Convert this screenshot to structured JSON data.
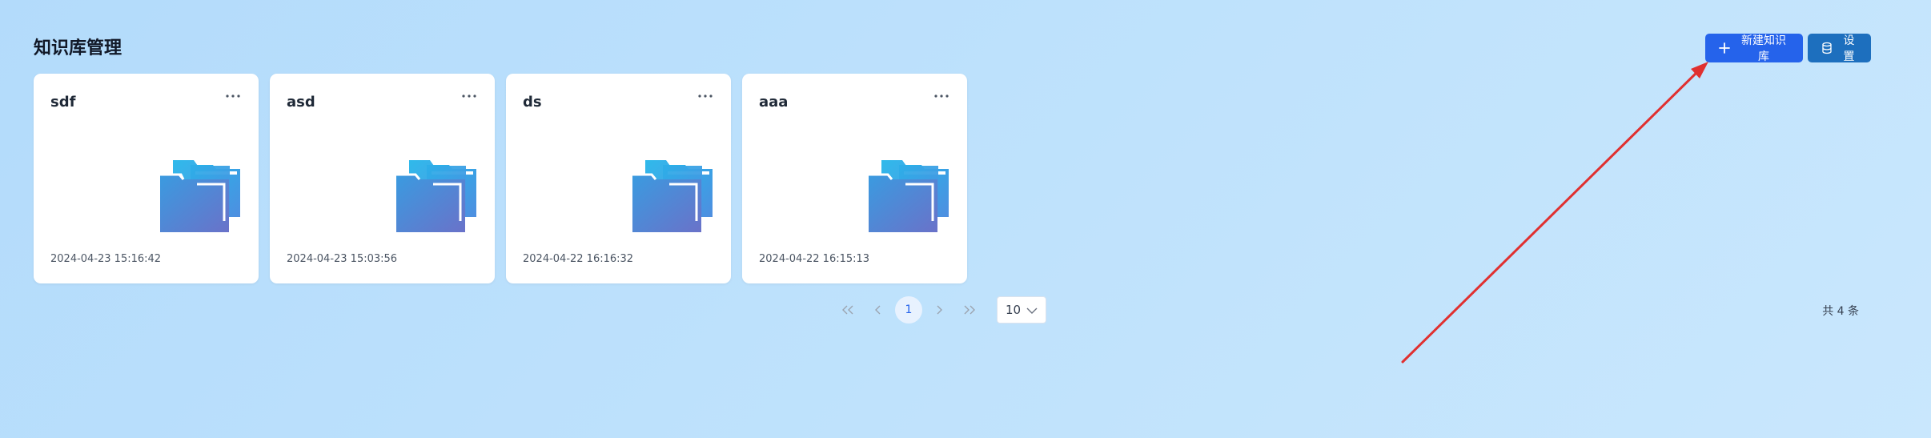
{
  "page": {
    "title": "知识库管理"
  },
  "toolbar": {
    "new_label": "新建知识库",
    "settings_label": "设置"
  },
  "cards": [
    {
      "name": "sdf",
      "date": "2024-04-23 15:16:42"
    },
    {
      "name": "asd",
      "date": "2024-04-23 15:03:56"
    },
    {
      "name": "ds",
      "date": "2024-04-22 16:16:32"
    },
    {
      "name": "aaa",
      "date": "2024-04-22 16:15:13"
    }
  ],
  "pagination": {
    "current_page": "1",
    "page_size": "10",
    "total": "共 4 条"
  },
  "colors": {
    "primary": "#2563eb",
    "settings": "#1d6fbe",
    "annotation_arrow": "#e03030"
  },
  "icons": {
    "add": "plus-icon",
    "settings": "database-icon",
    "card_menu": "more-dots-icon",
    "folder": "folder-icon"
  }
}
